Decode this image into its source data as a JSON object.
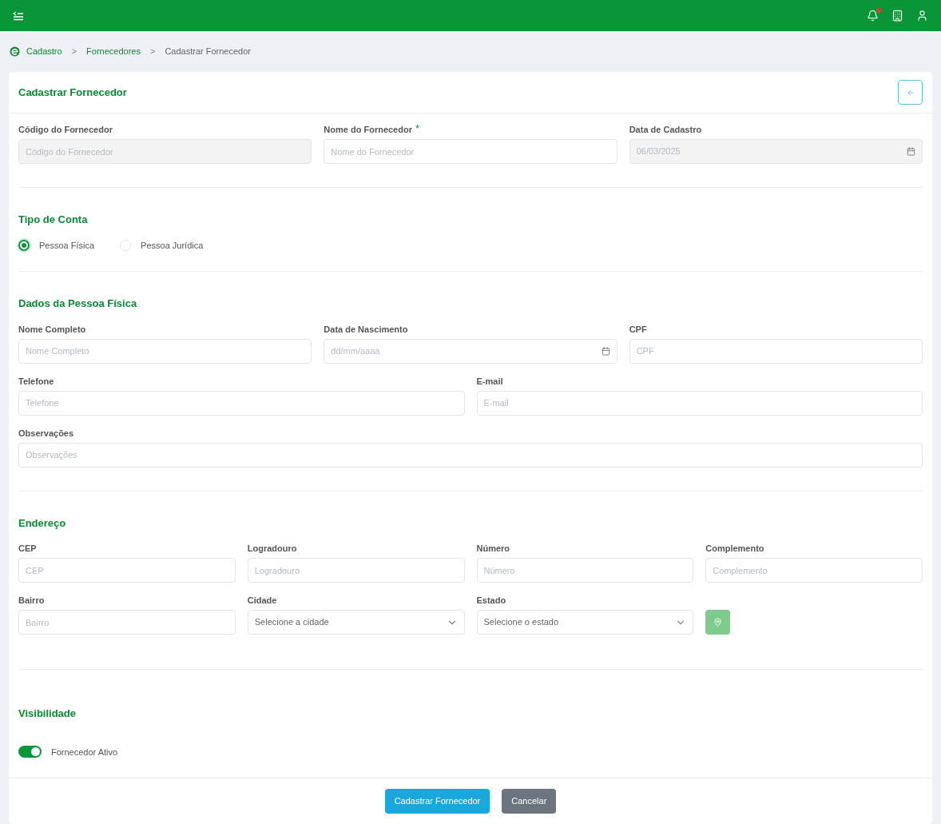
{
  "breadcrumb": [
    {
      "label": "Cadastro",
      "link": true
    },
    {
      "label": "Fornecedores",
      "link": true
    },
    {
      "label": "Cadastrar Fornecedor",
      "link": false
    }
  ],
  "separator": ">",
  "topbar": {
    "notification_dot": true
  },
  "card": {
    "title": "Cadastrar Fornecedor"
  },
  "header_fields": [
    {
      "kind": "input",
      "label": "Código do Fornecedor",
      "placeholder": "Código do Fornecedor",
      "disabled": true
    },
    {
      "kind": "input",
      "label": "Nome do Fornecedor",
      "placeholder": "Nome do Fornecedor",
      "disabled": false,
      "required_mark": "*"
    },
    {
      "kind": "date",
      "label": "Data de Cadastro",
      "value": "06/03/2025",
      "disabled": true
    }
  ],
  "account_type": {
    "title": "Tipo de Conta",
    "options": [
      {
        "label": "Pessoa Física",
        "selected": true
      },
      {
        "label": "Pessoa Jurídica",
        "selected": false
      }
    ]
  },
  "person": {
    "title": "Dados da Pessoa Física",
    "rows": [
      [
        {
          "kind": "input",
          "label": "Nome Completo",
          "placeholder": "Nome Completo"
        },
        {
          "kind": "date",
          "label": "Data de Nascimento",
          "placeholder": "dd/mm/aaaa"
        },
        {
          "kind": "input",
          "label": "CPF",
          "placeholder": "CPF"
        }
      ],
      [
        {
          "kind": "input",
          "label": "Telefone",
          "placeholder": "Telefone"
        },
        {
          "kind": "input",
          "label": "E-mail",
          "placeholder": "E-mail"
        }
      ],
      [
        {
          "kind": "input",
          "label": "Observações",
          "placeholder": "Observações"
        }
      ]
    ]
  },
  "address": {
    "title": "Endereço",
    "rows": [
      [
        {
          "kind": "input",
          "label": "CEP",
          "placeholder": "CEP"
        },
        {
          "kind": "input",
          "label": "Logradouro",
          "placeholder": "Logradouro"
        },
        {
          "kind": "input",
          "label": "Número",
          "placeholder": "Número"
        },
        {
          "kind": "input",
          "label": "Complemento",
          "placeholder": "Complemento"
        }
      ],
      [
        {
          "kind": "input",
          "label": "Bairro",
          "placeholder": "Bairro"
        },
        {
          "kind": "select",
          "label": "Cidade",
          "placeholder": "Selecione a cidade"
        },
        {
          "kind": "select",
          "label": "Estado",
          "placeholder": "Selecione o estado"
        },
        {
          "kind": "map_button"
        }
      ]
    ]
  },
  "visibility": {
    "title": "Visibilidade",
    "toggle": {
      "label": "Fornecedor Ativo",
      "on": true
    }
  },
  "buttons": [
    {
      "label": "Cadastrar Fornecedor",
      "kind": "primary"
    },
    {
      "label": "Cancelar",
      "kind": "secondary"
    }
  ]
}
